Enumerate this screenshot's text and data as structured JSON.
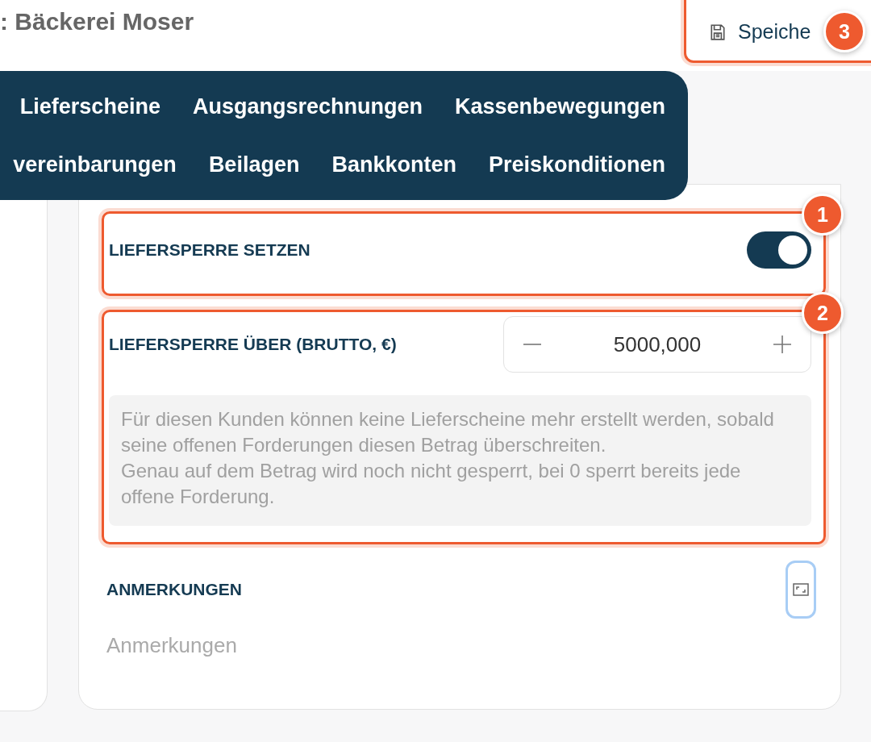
{
  "header": {
    "title": ": Bäckerei Moser",
    "save_button": {
      "label": "Speiche",
      "callout": "3"
    }
  },
  "tab_rows": [
    {
      "tabs": [
        "Lieferscheine",
        "Ausgangsrechnungen",
        "Kassenbewegungen"
      ]
    },
    {
      "tabs": [
        "vereinbarungen",
        "Beilagen",
        "Bankkonten",
        "Preiskonditionen"
      ]
    }
  ],
  "delivery_lock": {
    "label": "LIEFERSPERRE SETZEN",
    "on": true,
    "callout": "1"
  },
  "lock_threshold": {
    "label": "LIEFERSPERRE ÜBER (BRUTTO, €)",
    "value": "5000,000",
    "callout": "2",
    "hint": [
      "Für diesen Kunden können keine Lieferscheine mehr erstellt werden, sobald seine offenen Forderungen diesen Betrag überschreiten.",
      "Genau auf dem Betrag wird noch nicht gesperrt, bei 0 sperrt bereits jede offene Forderung."
    ]
  },
  "notes": {
    "label": "ANMERKUNGEN",
    "placeholder": "Anmerkungen"
  }
}
